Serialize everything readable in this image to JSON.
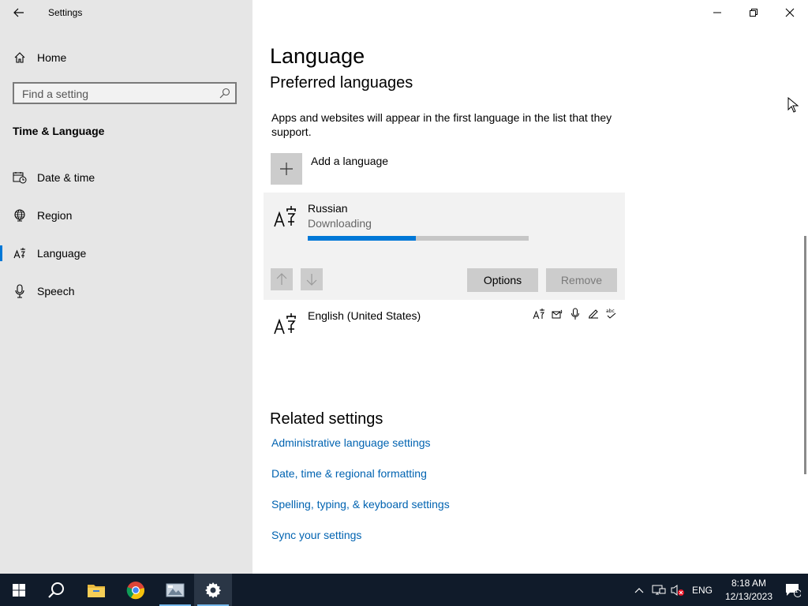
{
  "window": {
    "title": "Settings"
  },
  "sidebar": {
    "home_label": "Home",
    "search_placeholder": "Find a setting",
    "section_title": "Time & Language",
    "items": [
      {
        "label": "Date & time",
        "icon": "calendar-clock-icon"
      },
      {
        "label": "Region",
        "icon": "globe-icon"
      },
      {
        "label": "Language",
        "icon": "language-icon",
        "active": true
      },
      {
        "label": "Speech",
        "icon": "microphone-icon"
      }
    ]
  },
  "main": {
    "page_title": "Language",
    "section_heading": "Preferred languages",
    "description": "Apps and websites will appear in the first language in the list that they support.",
    "add_language_label": "Add a language",
    "languages": [
      {
        "name": "Russian",
        "status": "Downloading",
        "progress": 0.49,
        "options_label": "Options",
        "remove_label": "Remove"
      },
      {
        "name": "English (United States)",
        "features": [
          "display-language-icon",
          "text-to-speech-icon",
          "speech-recognition-icon",
          "handwriting-icon",
          "spelling-icon"
        ]
      }
    ],
    "related_heading": "Related settings",
    "related_links": [
      "Administrative language settings",
      "Date, time & regional formatting",
      "Spelling, typing, & keyboard settings",
      "Sync your settings"
    ]
  },
  "taskbar": {
    "apps": [
      "start-icon",
      "search-icon",
      "file-explorer-icon",
      "chrome-icon",
      "app-icon",
      "settings-icon"
    ],
    "tray": {
      "lang": "ENG",
      "time": "8:18 AM",
      "date": "12/13/2023",
      "notification_count": "1"
    }
  },
  "colors": {
    "accent": "#0078d7",
    "link": "#0063b1",
    "sidebar_bg": "#e6e6e6",
    "taskbar_bg": "#101b2a"
  }
}
